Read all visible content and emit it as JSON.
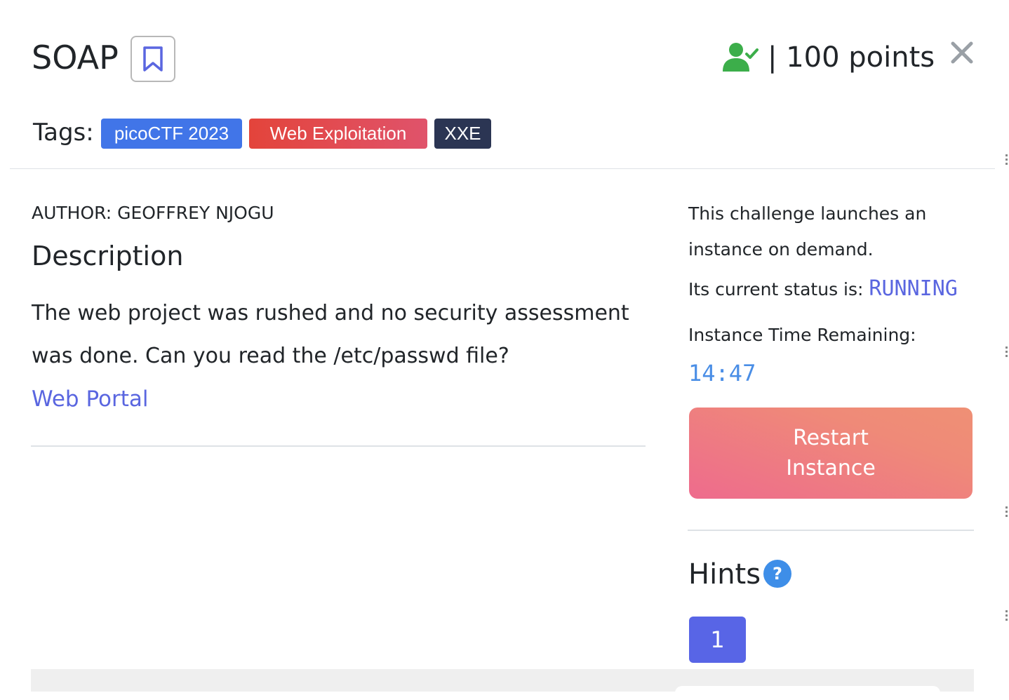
{
  "challenge": {
    "title": "SOAP",
    "points_text": "| 100 points",
    "tags_label": "Tags:",
    "tags": [
      {
        "label": "picoCTF 2023",
        "color": "#4175e8"
      },
      {
        "label": "Web Exploitation",
        "color": "#e3443b"
      },
      {
        "label": "XXE",
        "color": "#2b3553"
      }
    ]
  },
  "description": {
    "author": "AUTHOR: GEOFFREY NJOGU",
    "heading": "Description",
    "text": "The web project was rushed and no security assessment was done. Can you read the /etc/passwd file?",
    "link_label": "Web Portal"
  },
  "instance": {
    "launch_line_1": "This challenge launches an",
    "launch_line_2": "instance on demand.",
    "status_label": "Its current status is: ",
    "status_value": "RUNNING",
    "time_label": "Instance Time Remaining:",
    "time_value": "14:47",
    "restart_label": "Restart Instance"
  },
  "hints": {
    "heading": "Hints",
    "help_icon": "?",
    "buttons": [
      "1"
    ]
  },
  "icons": {
    "bookmark": "bookmark-icon",
    "solved": "user-check-icon",
    "close": "close-icon",
    "help": "question-circle-icon"
  },
  "colors": {
    "accent": "#5a66e0",
    "solved_green": "#3cae4a",
    "restart_gradient_start": "#ee6b8d",
    "restart_gradient_end": "#ef9075",
    "hint_button": "#5865e6"
  }
}
